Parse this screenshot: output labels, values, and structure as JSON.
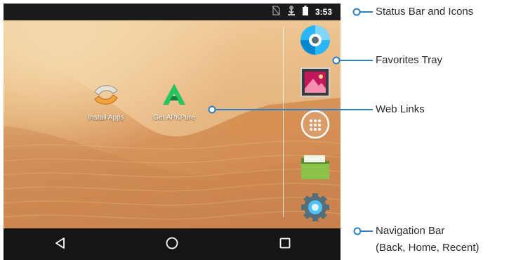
{
  "status_bar": {
    "time": "3:53",
    "icons": [
      "no-sim-icon",
      "download-notification-icon",
      "battery-icon"
    ]
  },
  "desktop_links": [
    {
      "label": "Install Apps",
      "icon": "install-apps-icon"
    },
    {
      "label": "Get APKPure",
      "icon": "apkpure-icon"
    }
  ],
  "favorites_tray": [
    {
      "icon": "camera-app-icon"
    },
    {
      "icon": "gallery-app-icon"
    },
    {
      "icon": "app-drawer-icon"
    },
    {
      "icon": "file-manager-icon"
    },
    {
      "icon": "settings-app-icon"
    }
  ],
  "nav_bar": {
    "buttons": [
      "back-icon",
      "home-icon",
      "recent-apps-icon"
    ]
  },
  "callouts": {
    "status": "Status Bar and Icons",
    "favorites": "Favorites Tray",
    "web_links": "Web Links",
    "navigation_line1": "Navigation Bar",
    "navigation_line2": "(Back, Home, Recent)"
  },
  "colors": {
    "callout_accent": "#2e7fc1",
    "status_bar_bg": "#1b1b1b",
    "nav_bar_bg": "#151515",
    "sand": "#d89860"
  }
}
